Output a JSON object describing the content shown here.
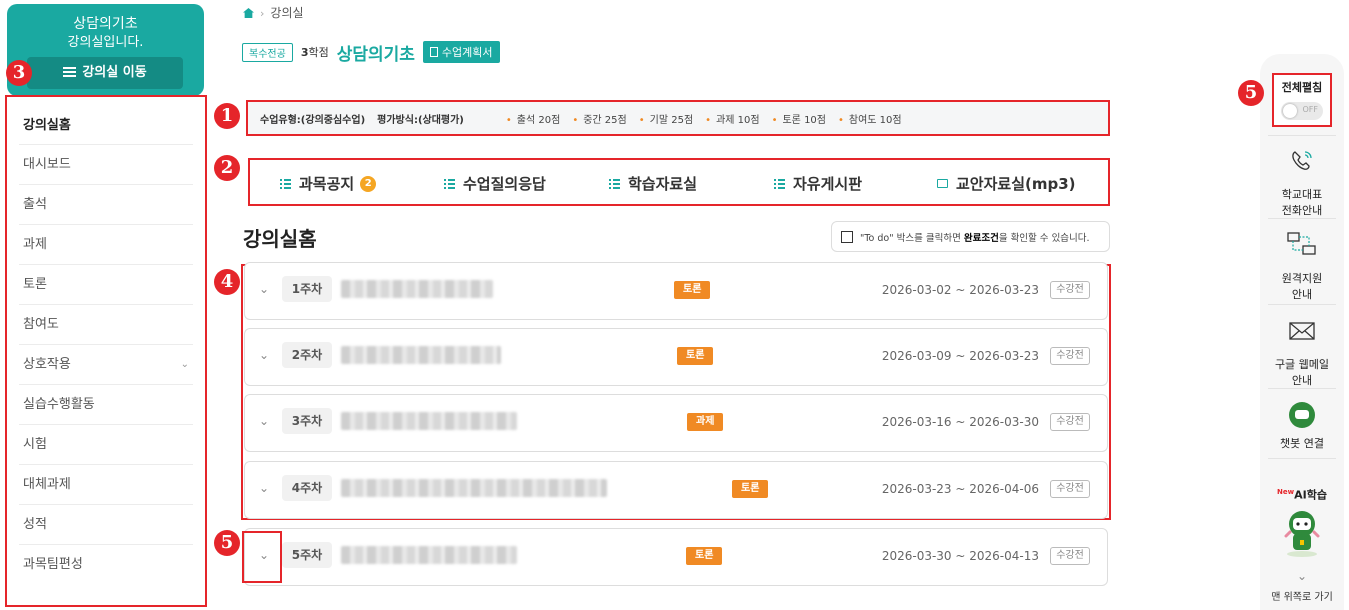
{
  "sidebar": {
    "course_name": "상담의기초",
    "subtitle": "강의실입니다.",
    "move_button": "강의실 이동",
    "items": [
      {
        "label": "강의실홈"
      },
      {
        "label": "대시보드"
      },
      {
        "label": "출석"
      },
      {
        "label": "과제"
      },
      {
        "label": "토론"
      },
      {
        "label": "참여도"
      },
      {
        "label": "상호작용"
      },
      {
        "label": "실습수행활동"
      },
      {
        "label": "시험"
      },
      {
        "label": "대체과제"
      },
      {
        "label": "성적"
      },
      {
        "label": "과목팀편성"
      }
    ]
  },
  "markers": {
    "m1": "1",
    "m2": "2",
    "m3": "3",
    "m4": "4",
    "m5": "5"
  },
  "breadcrumb": {
    "current": "강의실"
  },
  "header": {
    "major_tag": "복수전공",
    "credit_num": "3",
    "credit_unit": "학점",
    "course_title": "상담의기초",
    "plan_button": "수업계획서"
  },
  "eval": {
    "type": "수업유형:(강의중심수업)",
    "method": "평가방식:(상대평가)",
    "scores": [
      "출석 20점",
      "중간 25점",
      "기말 25점",
      "과제 10점",
      "토론 10점",
      "참여도 10점"
    ]
  },
  "tabs": [
    {
      "label": "과목공지",
      "count": "2"
    },
    {
      "label": "수업질의응답"
    },
    {
      "label": "학습자료실"
    },
    {
      "label": "자유게시판"
    },
    {
      "label": "교안자료실(mp3)"
    }
  ],
  "section": {
    "title": "강의실홈"
  },
  "todo": {
    "pre": "\"To do\" 박스를 클릭하면 ",
    "bold": "완료조건",
    "post": "을 확인할 수 있습니다."
  },
  "weeks": [
    {
      "week": "1주차",
      "tag": "토론",
      "date": "2026-03-02 ~ 2026-03-23",
      "status": "수강전"
    },
    {
      "week": "2주차",
      "tag": "토론",
      "date": "2026-03-09 ~ 2026-03-23",
      "status": "수강전"
    },
    {
      "week": "3주차",
      "tag": "과제",
      "date": "2026-03-16 ~ 2026-03-30",
      "status": "수강전"
    },
    {
      "week": "4주차",
      "tag": "토론",
      "date": "2026-03-23 ~ 2026-04-06",
      "status": "수강전"
    },
    {
      "week": "5주차",
      "tag": "토론",
      "date": "2026-03-30 ~ 2026-04-13",
      "status": "수강전"
    }
  ],
  "quickbar": {
    "toggle_label": "전체펼침",
    "toggle_state": "OFF",
    "items": [
      {
        "line1": "학교대표",
        "line2": "전화안내"
      },
      {
        "line1": "원격지원",
        "line2": "안내"
      },
      {
        "line1": "구글 웹메일",
        "line2": "안내"
      },
      {
        "line1": "챗봇 연결"
      }
    ],
    "ai_new": "New",
    "ai_label": "AI학습",
    "more": "맨 위쪽로 가기"
  },
  "colors": {
    "accent": "#1aa9a1",
    "highlight": "#e5252a",
    "tag": "#f08a24"
  }
}
